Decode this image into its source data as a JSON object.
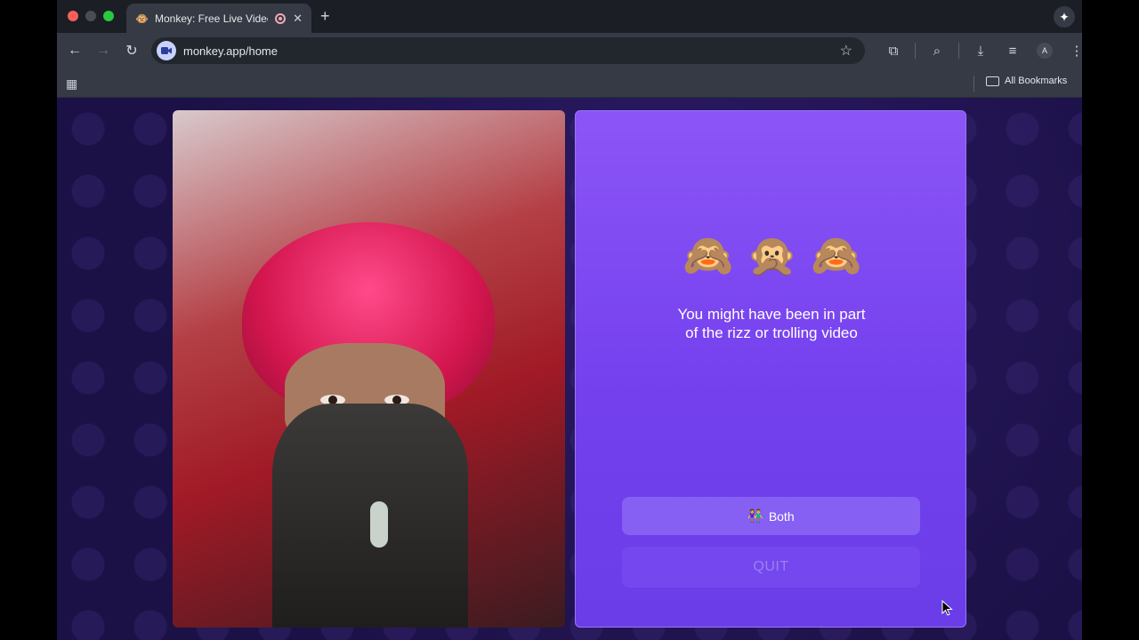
{
  "browser": {
    "tab": {
      "favicon": "🐵",
      "title": "Monkey: Free Live Video C",
      "recording_icon": "recording-icon",
      "close_label": "✕"
    },
    "new_tab_label": "+",
    "address_bar": {
      "url": "monkey.app/home"
    },
    "toolbar": {
      "back": "←",
      "forward": "→",
      "reload": "↻",
      "bookmark_star": "☆",
      "extensions": "⧉",
      "tab_search": "⌕",
      "download": "⤓",
      "media": "≡",
      "profile_initial": "A",
      "menu": "⋮"
    },
    "bookmarks_bar": {
      "apps_icon": "apps-grid-icon",
      "all_bookmarks_label": "All Bookmarks"
    }
  },
  "page": {
    "monkeys": [
      "🙈",
      "🙊",
      "🙈"
    ],
    "message": "You might have been in part of the rizz or trolling video",
    "both_button": {
      "icon": "👫",
      "label": "Both"
    },
    "quit_button": {
      "label": "QUIT"
    }
  },
  "colors": {
    "panel_purple": "#7440ee",
    "page_background": "#1c1147",
    "browser_chrome": "#353a44"
  }
}
